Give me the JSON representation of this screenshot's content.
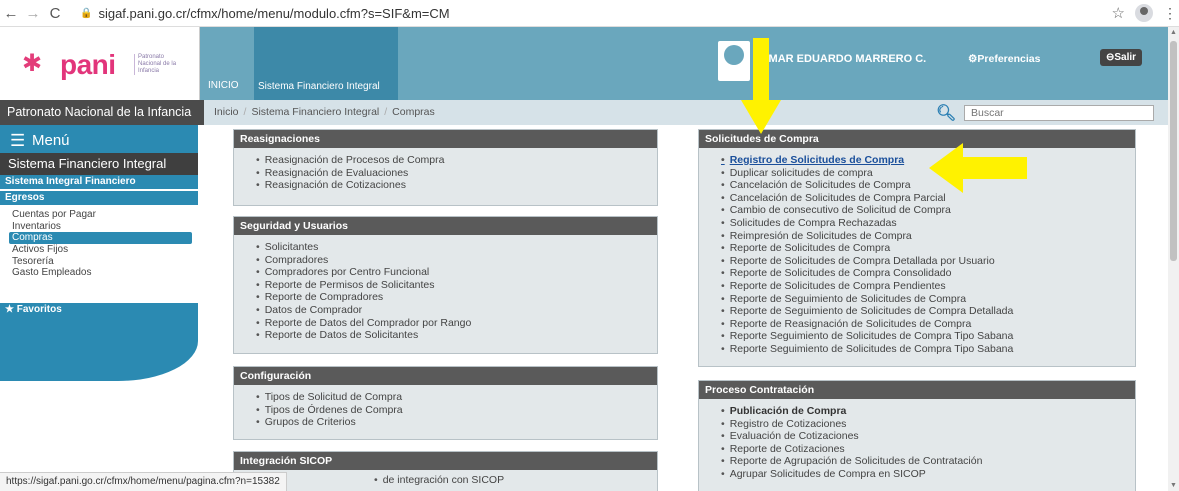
{
  "browser": {
    "url": "sigaf.pani.go.cr/cfmx/home/menu/modulo.cfm?s=SIF&m=CM",
    "back_icon": "back-arrow-icon",
    "forward_icon": "forward-arrow-icon",
    "reload_icon": "reload-icon"
  },
  "header": {
    "logo_text": "pani",
    "logo_sub": "Patronato Nacional de la Infancia",
    "tab_inicio": "INICIO",
    "tab_active": "Sistema Financiero Integral",
    "user_name": "OMAR EDUARDO MARRERO C.",
    "preferences": "⚙Preferencias",
    "logout": "⊖Salir",
    "accent": "#6aa7bd"
  },
  "breadcrumb_bar": {
    "org_name": "Patronato Nacional de la Infancia",
    "items": [
      "Inicio",
      "Sistema Financiero Integral",
      "Compras"
    ],
    "search_placeholder": "Buscar"
  },
  "sidebar": {
    "menu_label": "Menú",
    "section_title": "Sistema Financiero Integral",
    "system_label": "Sistema Integral Financiero",
    "group_label": "Egresos",
    "items": [
      "Cuentas por Pagar",
      "Inventarios",
      "Compras",
      "Activos Fijos",
      "Tesorería",
      "Gasto Empleados"
    ],
    "active_item": "Compras",
    "favorites_label": "★ Favoritos"
  },
  "panels": {
    "reasignaciones": {
      "title": "Reasignaciones",
      "items": [
        "Reasignación de Procesos de Compra",
        "Reasignación de Evaluaciones",
        "Reasignación de Cotizaciones"
      ]
    },
    "seguridad": {
      "title": "Seguridad y Usuarios",
      "items": [
        "Solicitantes",
        "Compradores",
        "Compradores por Centro Funcional",
        "Reporte de Permisos de Solicitantes",
        "Reporte de Compradores",
        "Datos de Comprador",
        "Reporte de Datos del Comprador por Rango",
        "Reporte de Datos de Solicitantes"
      ]
    },
    "configuracion": {
      "title": "Configuración",
      "items": [
        "Tipos de Solicitud de Compra",
        "Tipos de Órdenes de Compra",
        "Grupos de Criterios"
      ]
    },
    "integracion": {
      "title": "Integración SICOP",
      "items": [
        "de integración con SICOP"
      ]
    },
    "solicitudes": {
      "title": "Solicitudes de Compra",
      "items": [
        "Registro de Solicitudes de Compra",
        "Duplicar solicitudes de compra",
        "Cancelación de Solicitudes de Compra",
        "Cancelación de Solicitudes de Compra Parcial",
        "Cambio de consecutivo de Solicitud de Compra",
        "Solicitudes de Compra Rechazadas",
        "Reimpresión de Solicitudes de Compra",
        "Reporte de Solicitudes de Compra",
        "Reporte de Solicitudes de Compra Detallada por Usuario",
        "Reporte de Solicitudes de Compra Consolidado",
        "Reporte de Solicitudes de Compra Pendientes",
        "Reporte de Seguimiento de Solicitudes de Compra",
        "Reporte de Seguimiento de Solicitudes de Compra Detallada",
        "Reporte de Reasignación de Solicitudes de Compra",
        "Reporte Seguimiento de Solicitudes de Compra Tipo Sabana",
        "Reporte Seguimiento de Solicitudes de Compra Tipo Sabana"
      ]
    },
    "contratacion": {
      "title": "Proceso Contratación",
      "items": [
        "Publicación de Compra",
        "Registro de Cotizaciones",
        "Evaluación de Cotizaciones",
        "Reporte de Cotizaciones",
        "Reporte de Agrupación de Solicitudes de Contratación",
        "Agrupar Solicitudes de Compra en SICOP"
      ]
    }
  },
  "status_bar": "https://sigaf.pani.go.cr/cfmx/home/menu/pagina.cfm?n=15382",
  "annotation_color": "#fff200"
}
